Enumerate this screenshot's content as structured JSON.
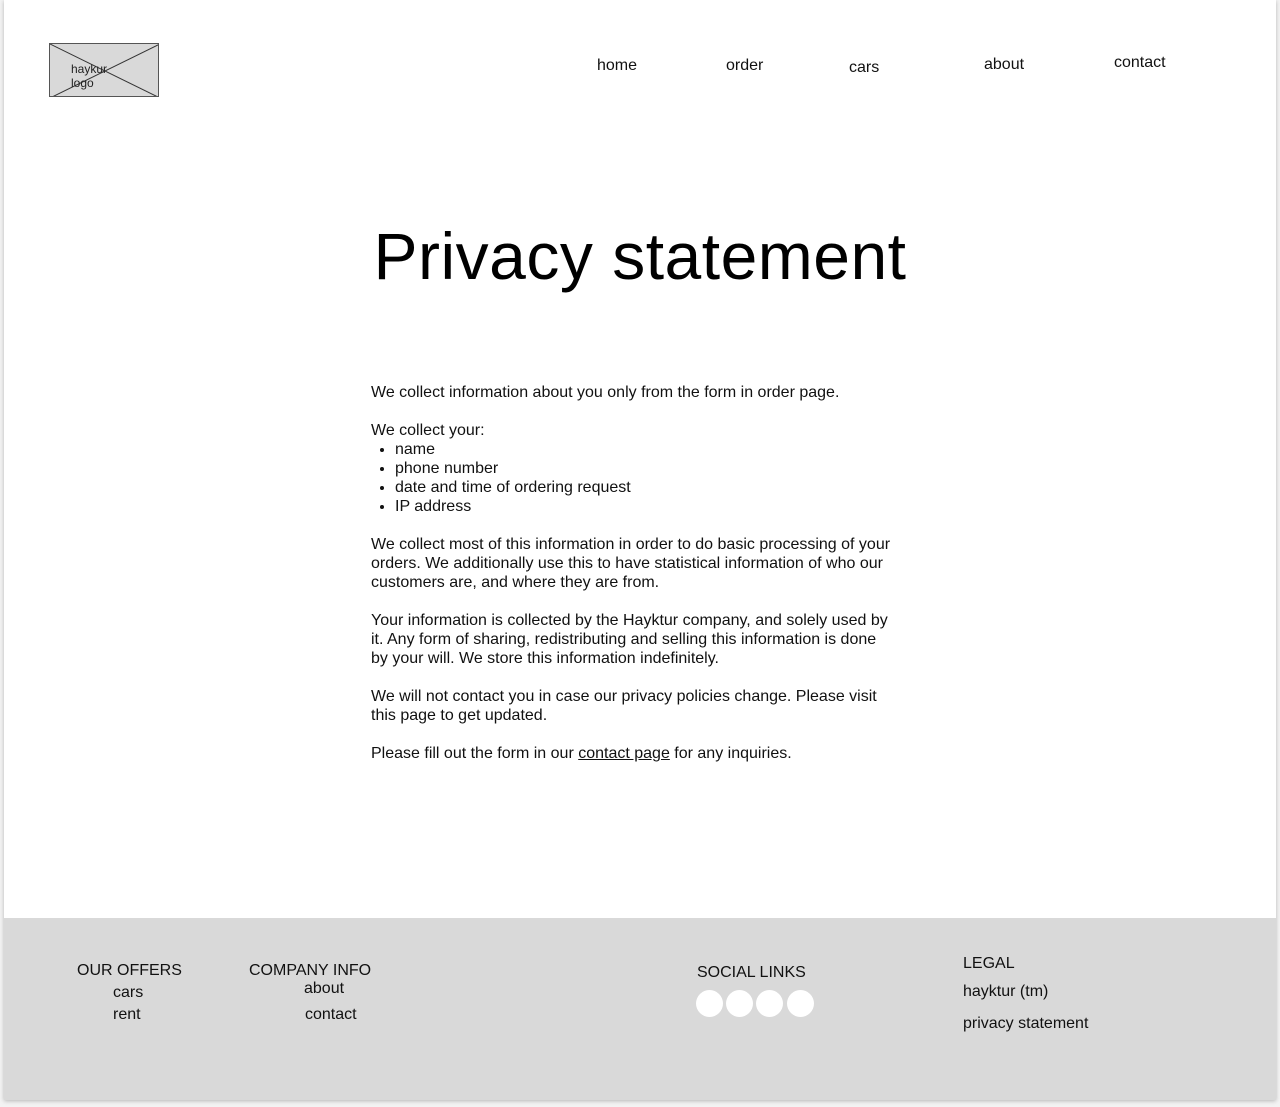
{
  "header": {
    "logo_text": "haykur\nlogo",
    "nav": {
      "home": "home",
      "order": "order",
      "cars": "cars",
      "about": "about",
      "contact": "contact"
    }
  },
  "main": {
    "title": "Privacy statement",
    "paragraph_1": "We collect information about you only from the form in order page.",
    "collect_label": "We collect your:",
    "collect_items": [
      "name",
      "phone number",
      "date and time of ordering request",
      "IP address"
    ],
    "paragraph_2": "We collect most of this information in order to do basic processing of your orders. We additionally use this to have statistical information of who our customers are, and where they are from.",
    "paragraph_3": "Your information is collected by the Hayktur company, and solely used by it. Any form of sharing, redistributing and selling this information is done by your will. We store this information indefinitely.",
    "paragraph_4": "We will not contact you in case our privacy policies change. Please visit this page to get updated.",
    "paragraph_5_before": "Please fill out the form in our ",
    "paragraph_5_link": "contact page",
    "paragraph_5_after": " for any inquiries."
  },
  "footer": {
    "offers": {
      "heading": "OUR OFFERS",
      "links": [
        "cars",
        "rent"
      ]
    },
    "company": {
      "heading": "COMPANY INFO",
      "links": [
        "about",
        "contact"
      ]
    },
    "social": {
      "heading": "SOCIAL LINKS",
      "icons": [
        "social-icon-1",
        "social-icon-2",
        "social-icon-3",
        "social-icon-4"
      ]
    },
    "legal": {
      "heading": "LEGAL",
      "links": [
        "hayktur (tm)",
        "privacy statement"
      ]
    }
  },
  "colors": {
    "footer_bg": "#d9d9d9",
    "logo_bg": "#d9d9d9",
    "text": "#111111"
  }
}
